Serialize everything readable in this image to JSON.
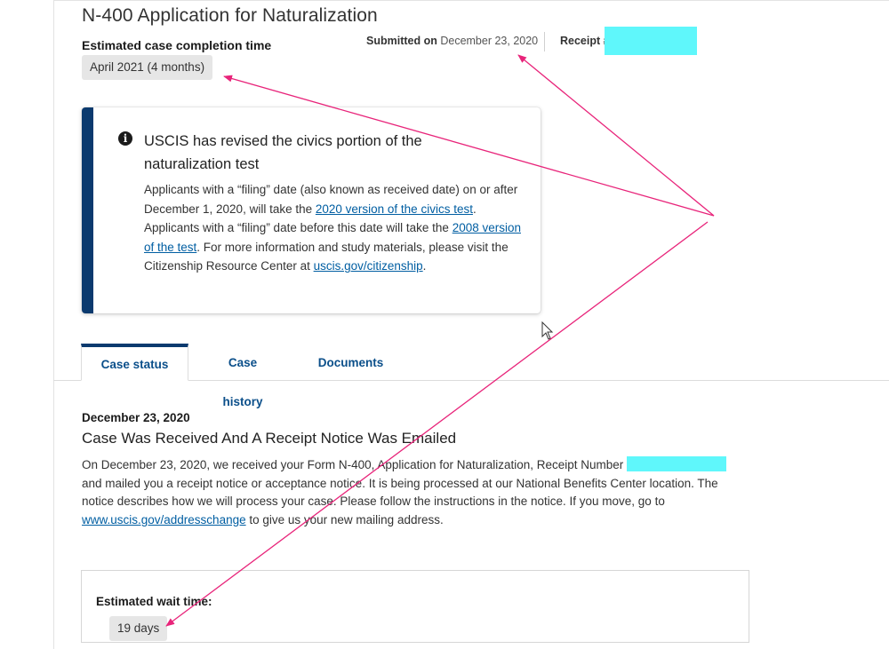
{
  "header": {
    "title": "N-400 Application for Naturalization",
    "estimate_label": "Estimated case completion time",
    "estimate_value": "April 2021 (4 months)",
    "submitted_label": "Submitted on",
    "submitted_date": "December 23, 2020",
    "receipt_label": "Receipt #"
  },
  "alert": {
    "icon": "info-icon",
    "title": "USCIS has revised the civics portion of the naturalization test",
    "body_1": "Applicants with a “filing” date (also known as received date) on or after December 1, 2020, will take the ",
    "link_1": "2020 version of the civics test",
    "body_2": ". Applicants with a “filing” date before this date will take the ",
    "link_2": "2008 version of the test",
    "body_3": ". For more information and study materials, please visit the Citizenship Resource Center at ",
    "link_3": "uscis.gov/citizenship",
    "body_4": "."
  },
  "tabs": [
    {
      "label": "Case status",
      "active": true
    },
    {
      "label": "Case history",
      "active": false
    },
    {
      "label": "Documents",
      "active": false
    }
  ],
  "status": {
    "date": "December 23, 2020",
    "heading": "Case Was Received And A Receipt Notice Was Emailed",
    "text_1": "On December 23, 2020, we received your Form N-400, Application for Naturalization, Receipt Number ",
    "text_2": " and mailed you a receipt notice or acceptance notice. It is being processed at our National Benefits Center location. The notice describes how we will process your case. Please follow the instructions in the notice. If you move, go to ",
    "link": "www.uscis.gov/addresschange",
    "text_3": " to give us your new mailing address."
  },
  "wait": {
    "label": "Estimated wait time:",
    "value": "19 days"
  },
  "colors": {
    "redaction": "#5ff7fb",
    "annotation_arrow": "#e8247a",
    "alert_bar": "#0b3a6e",
    "link": "#005ea2"
  }
}
